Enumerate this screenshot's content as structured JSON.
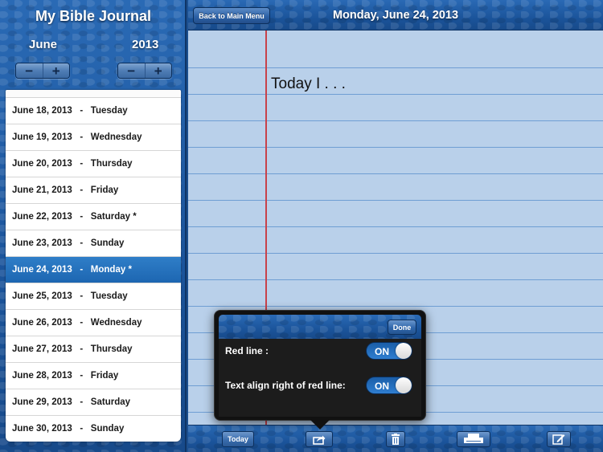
{
  "sidebar": {
    "title": "My Bible Journal",
    "month": "June",
    "year": "2013",
    "decrement_label": "−",
    "increment_label": "+",
    "days": [
      {
        "label": "June 18, 2013   -   Tuesday",
        "selected": false
      },
      {
        "label": "June 19, 2013   -   Wednesday",
        "selected": false
      },
      {
        "label": "June 20, 2013   -   Thursday",
        "selected": false
      },
      {
        "label": "June 21, 2013   -   Friday",
        "selected": false
      },
      {
        "label": "June 22, 2013   -   Saturday *",
        "selected": false
      },
      {
        "label": "June 23, 2013   -   Sunday",
        "selected": false
      },
      {
        "label": "June 24, 2013   -   Monday *",
        "selected": true
      },
      {
        "label": "June 25, 2013   -   Tuesday",
        "selected": false
      },
      {
        "label": "June 26, 2013   -   Wednesday",
        "selected": false
      },
      {
        "label": "June 27, 2013   -   Thursday",
        "selected": false
      },
      {
        "label": "June 28, 2013   -   Friday",
        "selected": false
      },
      {
        "label": "June 29, 2013   -   Saturday",
        "selected": false
      },
      {
        "label": "June 30, 2013   -   Sunday",
        "selected": false
      }
    ]
  },
  "header": {
    "back_label": "Back to Main Menu",
    "date_title": "Monday, June 24, 2013"
  },
  "journal": {
    "text": "Today I . . ."
  },
  "toolbar": {
    "today_label": "Today",
    "share_icon": "share-icon",
    "trash_icon": "trash-icon",
    "print_icon": "print-icon",
    "compose_icon": "compose-icon"
  },
  "popover": {
    "done_label": "Done",
    "options": [
      {
        "label": "Red line :",
        "state": "ON"
      },
      {
        "label": "Text align right of red line:",
        "state": "ON"
      }
    ]
  },
  "colors": {
    "accent_blue": "#1d5aa3",
    "selected_row": "#1d66b1",
    "red_margin": "#c8414a",
    "paper": "#b9d0ea",
    "ruled_line": "#6f9ed3"
  }
}
